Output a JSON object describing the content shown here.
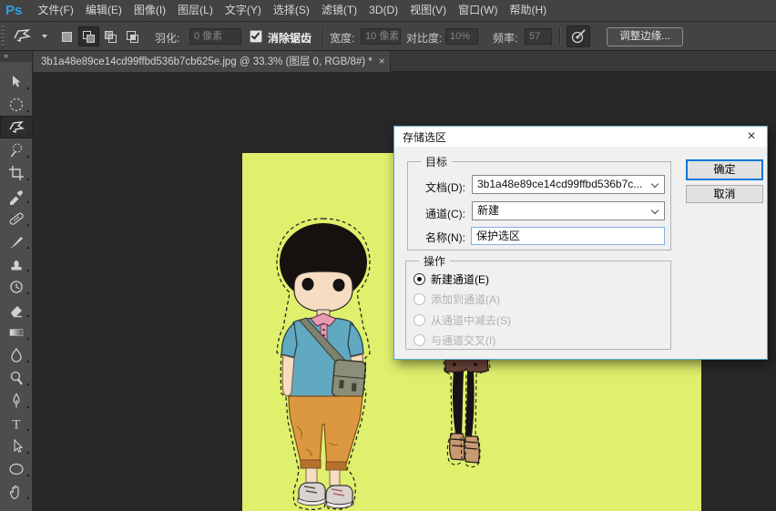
{
  "menubar": {
    "logo": "Ps",
    "items": [
      "文件(F)",
      "编辑(E)",
      "图像(I)",
      "图层(L)",
      "文字(Y)",
      "选择(S)",
      "滤镜(T)",
      "3D(D)",
      "视图(V)",
      "窗口(W)",
      "帮助(H)"
    ]
  },
  "options_bar": {
    "tool_preset_icon": "polygonal-lasso-icon",
    "selection_modes": [
      {
        "icon": "new-selection-icon",
        "pressed": false
      },
      {
        "icon": "add-to-selection-icon",
        "pressed": true
      },
      {
        "icon": "subtract-from-selection-icon",
        "pressed": false
      },
      {
        "icon": "intersect-selection-icon",
        "pressed": false
      }
    ],
    "feather": {
      "label": "羽化:",
      "value": "0 像素"
    },
    "anti_alias": {
      "label": "消除锯齿",
      "checked": true
    },
    "width": {
      "label": "宽度:",
      "value": "10 像素"
    },
    "contrast": {
      "label": "对比度:",
      "value": "10%"
    },
    "frequency": {
      "label": "频率:",
      "value": "57"
    },
    "pen_pressure_icon": "tablet-pressure-icon",
    "refine_edge_button": "调整边缘..."
  },
  "document_tab": {
    "title": "3b1a48e89ce14cd99ffbd536b7cb625e.jpg @ 33.3% (图层 0, RGB/8#) *",
    "close": "×"
  },
  "toolbar": {
    "collapse_glyph": "»",
    "tools": [
      "move-tool",
      "elliptical-marquee-tool",
      "polygonal-lasso-tool",
      "quick-selection-tool",
      "crop-tool",
      "eyedropper-tool",
      "spot-healing-brush-tool",
      "brush-tool",
      "clone-stamp-tool",
      "history-brush-tool",
      "eraser-tool",
      "gradient-tool",
      "blur-tool",
      "dodge-tool",
      "pen-tool",
      "type-tool",
      "path-selection-tool",
      "ellipse-tool",
      "hand-tool"
    ],
    "active_tool": "polygonal-lasso-tool"
  },
  "dialog": {
    "title": "存储选区",
    "close": "×",
    "dest_group": "目标",
    "doc_label": "文档(D):",
    "doc_value": "3b1a48e89ce14cd99ffbd536b7c...",
    "channel_label": "通道(C):",
    "channel_value": "新建",
    "name_label": "名称(N):",
    "name_value": "保护选区",
    "ok_button": "确定",
    "cancel_button": "取消",
    "op_group": "操作",
    "operations": [
      {
        "label": "新建通道(E)",
        "selected": true,
        "enabled": true
      },
      {
        "label": "添加到通道(A)",
        "selected": false,
        "enabled": false
      },
      {
        "label": "从通道中减去(S)",
        "selected": false,
        "enabled": false
      },
      {
        "label": "与通道交叉(I)",
        "selected": false,
        "enabled": false
      }
    ]
  },
  "canvas": {
    "background_color": "#def06c",
    "zoom_level": "33.3%"
  }
}
